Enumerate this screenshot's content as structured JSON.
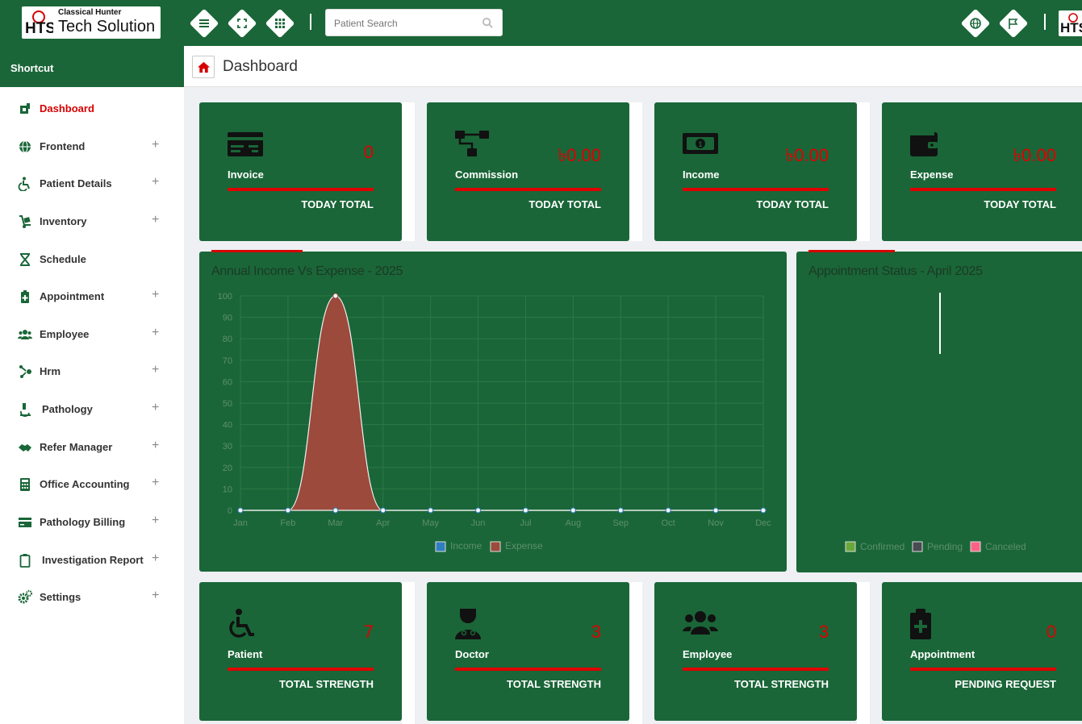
{
  "brand": {
    "tagline": "Classical Hunter",
    "name": "Tech Solution",
    "mark": "HTS"
  },
  "topbar": {
    "icons": [
      "menu-icon",
      "fullscreen-icon",
      "apps-grid-icon"
    ],
    "search_placeholder": "Patient Search",
    "right_icons": [
      "globe-icon",
      "flag-icon"
    ]
  },
  "sidebar": {
    "header": "Shortcut",
    "items": [
      {
        "label": "Dashboard",
        "icon": "dashboard-icon",
        "expandable": false,
        "active": true
      },
      {
        "label": "Frontend",
        "icon": "globe-icon",
        "expandable": true
      },
      {
        "label": "Patient Details",
        "icon": "wheelchair-icon",
        "expandable": true
      },
      {
        "label": "Inventory",
        "icon": "dolly-icon",
        "expandable": true
      },
      {
        "label": "Schedule",
        "icon": "hourglass-icon",
        "expandable": false
      },
      {
        "label": "Appointment",
        "icon": "clipboard-plus-icon",
        "expandable": true
      },
      {
        "label": "Employee",
        "icon": "users-icon",
        "expandable": true
      },
      {
        "label": "Hrm",
        "icon": "hrm-icon",
        "expandable": true
      },
      {
        "label": "Pathology",
        "icon": "microscope-icon",
        "expandable": true
      },
      {
        "label": "Refer Manager",
        "icon": "handshake-icon",
        "expandable": true
      },
      {
        "label": "Office Accounting",
        "icon": "calculator-icon",
        "expandable": true
      },
      {
        "label": "Pathology Billing",
        "icon": "billing-card-icon",
        "expandable": true
      },
      {
        "label": "Investigation Report",
        "icon": "clipboard-icon",
        "expandable": true
      },
      {
        "label": "Settings",
        "icon": "cogs-icon",
        "expandable": true
      }
    ],
    "expand_symbol": "+"
  },
  "page": {
    "title": "Dashboard"
  },
  "top_cards": [
    {
      "label": "Invoice",
      "value": "0",
      "footer": "TODAY TOTAL",
      "icon": "invoice-card-icon"
    },
    {
      "label": "Commission",
      "value": "৳0.00",
      "footer": "TODAY TOTAL",
      "icon": "sitemap-icon"
    },
    {
      "label": "Income",
      "value": "৳0.00",
      "footer": "TODAY TOTAL",
      "icon": "money-bill-icon"
    },
    {
      "label": "Expense",
      "value": "৳0.00",
      "footer": "TODAY TOTAL",
      "icon": "wallet-icon"
    }
  ],
  "bottom_cards": [
    {
      "label": "Patient",
      "value": "7",
      "footer": "TOTAL STRENGTH",
      "icon": "wheelchair-icon"
    },
    {
      "label": "Doctor",
      "value": "3",
      "footer": "TOTAL STRENGTH",
      "icon": "doctor-icon"
    },
    {
      "label": "Employee",
      "value": "3",
      "footer": "TOTAL STRENGTH",
      "icon": "users-icon"
    },
    {
      "label": "Appointment",
      "value": "0",
      "footer": "PENDING REQUEST",
      "icon": "clipboard-plus-icon"
    }
  ],
  "colors": {
    "brand_green": "#1a6638",
    "accent_red": "#d60000",
    "expense_fill": "#9b4a3c"
  },
  "chart_data": [
    {
      "type": "area",
      "title": "Annual Income Vs Expense - 2025",
      "categories": [
        "Jan",
        "Feb",
        "Mar",
        "Apr",
        "May",
        "Jun",
        "Jul",
        "Aug",
        "Sep",
        "Oct",
        "Nov",
        "Dec"
      ],
      "series": [
        {
          "name": "Income",
          "values": [
            0,
            0,
            0,
            0,
            0,
            0,
            0,
            0,
            0,
            0,
            0,
            0
          ],
          "color": "#2f7fbf"
        },
        {
          "name": "Expense",
          "values": [
            0,
            0,
            100,
            0,
            0,
            0,
            0,
            0,
            0,
            0,
            0,
            0
          ],
          "color": "#9b4a3c"
        }
      ],
      "yticks": [
        "0",
        "10",
        "20",
        "30",
        "40",
        "50",
        "60",
        "70",
        "80",
        "90",
        "100"
      ],
      "ylim": [
        0,
        100
      ],
      "grid": true,
      "legend": "bottom"
    },
    {
      "type": "pie",
      "title": "Appointment Status - April 2025",
      "categories": [
        "Confirmed",
        "Pending",
        "Canceled"
      ],
      "legend_colors": [
        "#6aa83a",
        "#4a4a52",
        "#ff6384"
      ],
      "legend": "bottom"
    }
  ]
}
